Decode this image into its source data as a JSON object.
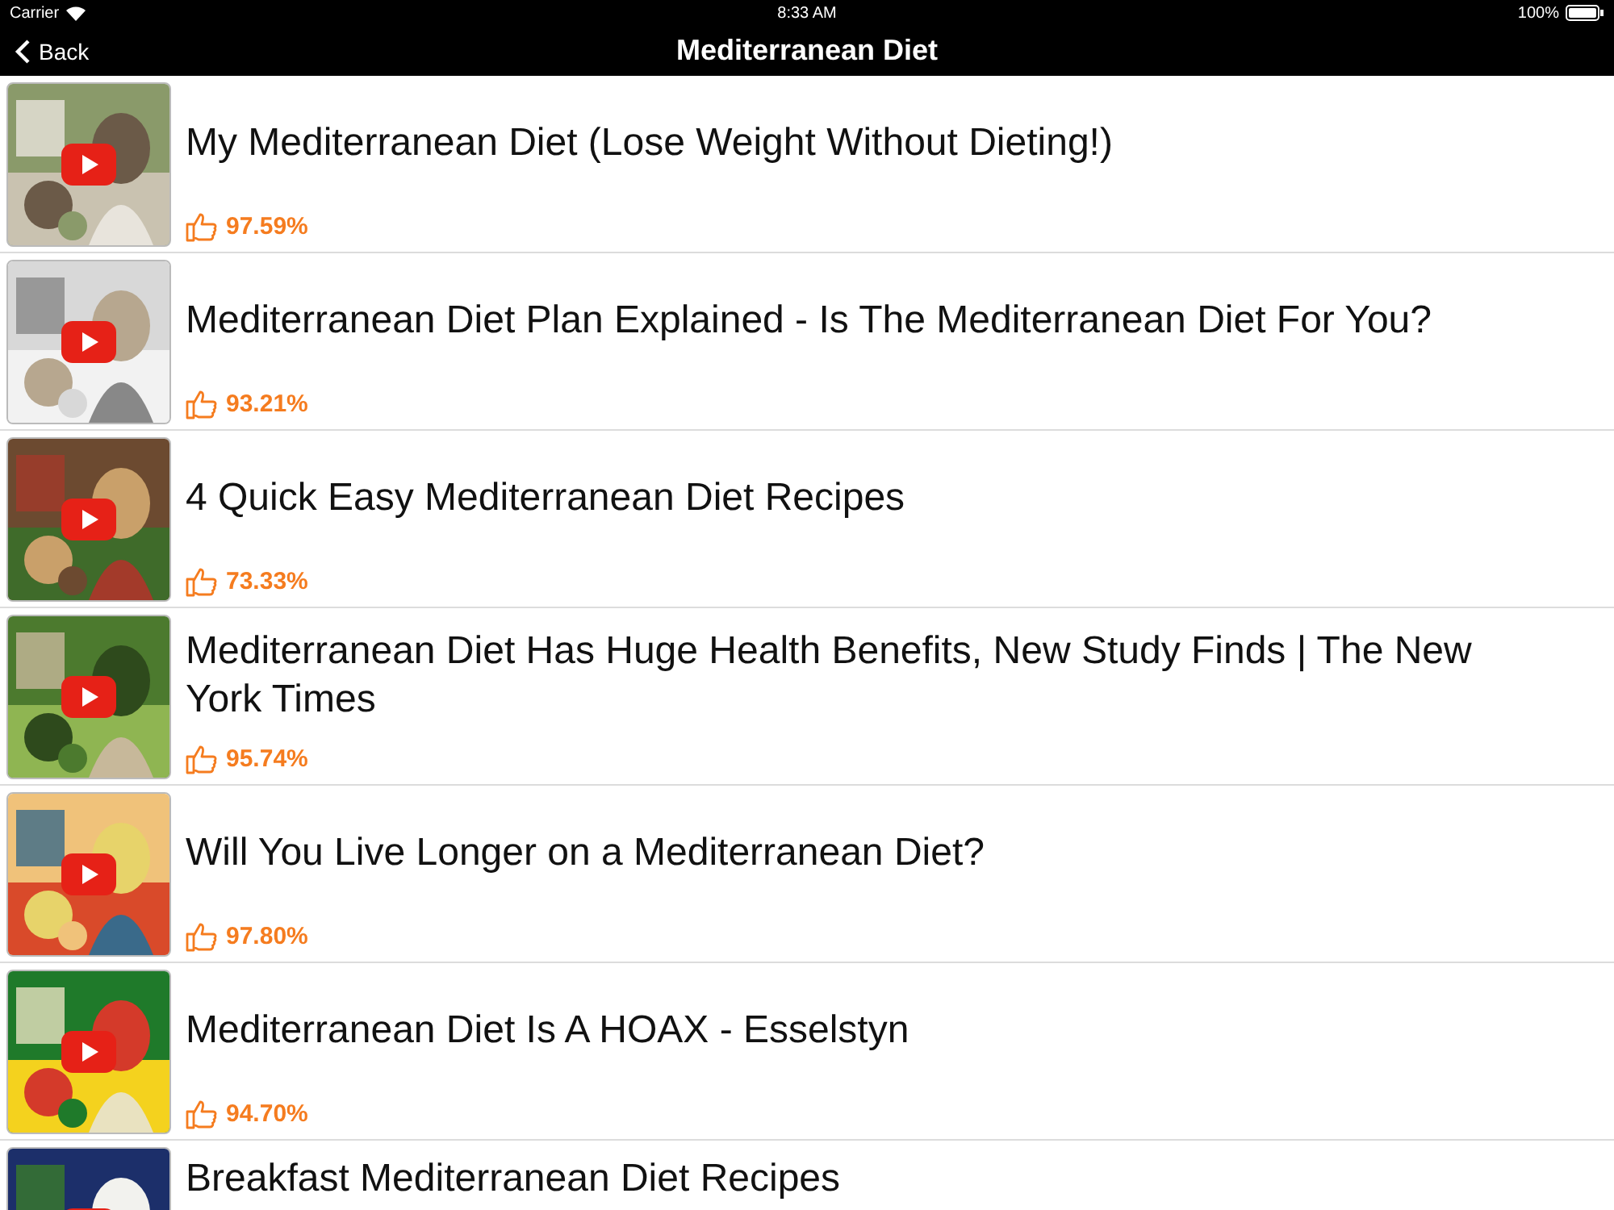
{
  "status_bar": {
    "carrier": "Carrier",
    "time": "8:33 AM",
    "battery": "100%"
  },
  "nav_bar": {
    "back": "Back",
    "title": "Mediterranean Diet"
  },
  "videos": [
    {
      "title": "My Mediterranean Diet (Lose Weight Without Dieting!)",
      "rating": "97.59%"
    },
    {
      "title": "Mediterranean Diet Plan Explained - Is The Mediterranean Diet For You?",
      "rating": "93.21%"
    },
    {
      "title": "4 Quick Easy Mediterranean Diet Recipes",
      "rating": "73.33%"
    },
    {
      "title": "Mediterranean Diet Has Huge Health Benefits, New Study Finds | The New York Times",
      "rating": "95.74%"
    },
    {
      "title": "Will You Live Longer on a Mediterranean Diet?",
      "rating": "97.80%"
    },
    {
      "title": "Mediterranean Diet Is A HOAX - Esselstyn",
      "rating": "94.70%"
    },
    {
      "title": "Breakfast Mediterranean Diet Recipes"
    }
  ]
}
